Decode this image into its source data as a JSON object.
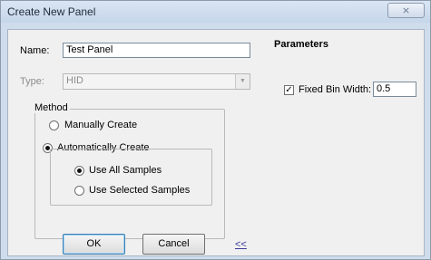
{
  "window": {
    "title": "Create New Panel",
    "close_label": "⨯"
  },
  "form": {
    "name_label": "Name:",
    "name_value": "Test Panel",
    "type_label": "Type:",
    "type_value": "HID"
  },
  "method": {
    "group_label": "Method",
    "manual_label": "Manually Create",
    "auto_label": "Automatically Create",
    "selected": "Automatically Create",
    "auto": {
      "all_label": "Use All Samples",
      "selected_label": "Use Selected Samples",
      "selected": "Use All Samples"
    }
  },
  "parameters": {
    "title": "Parameters",
    "fixed_bin_label": "Fixed Bin Width:",
    "fixed_bin_checked": true,
    "fixed_bin_value": "0.5"
  },
  "buttons": {
    "ok": "OK",
    "cancel": "Cancel",
    "collapse": "<<"
  }
}
